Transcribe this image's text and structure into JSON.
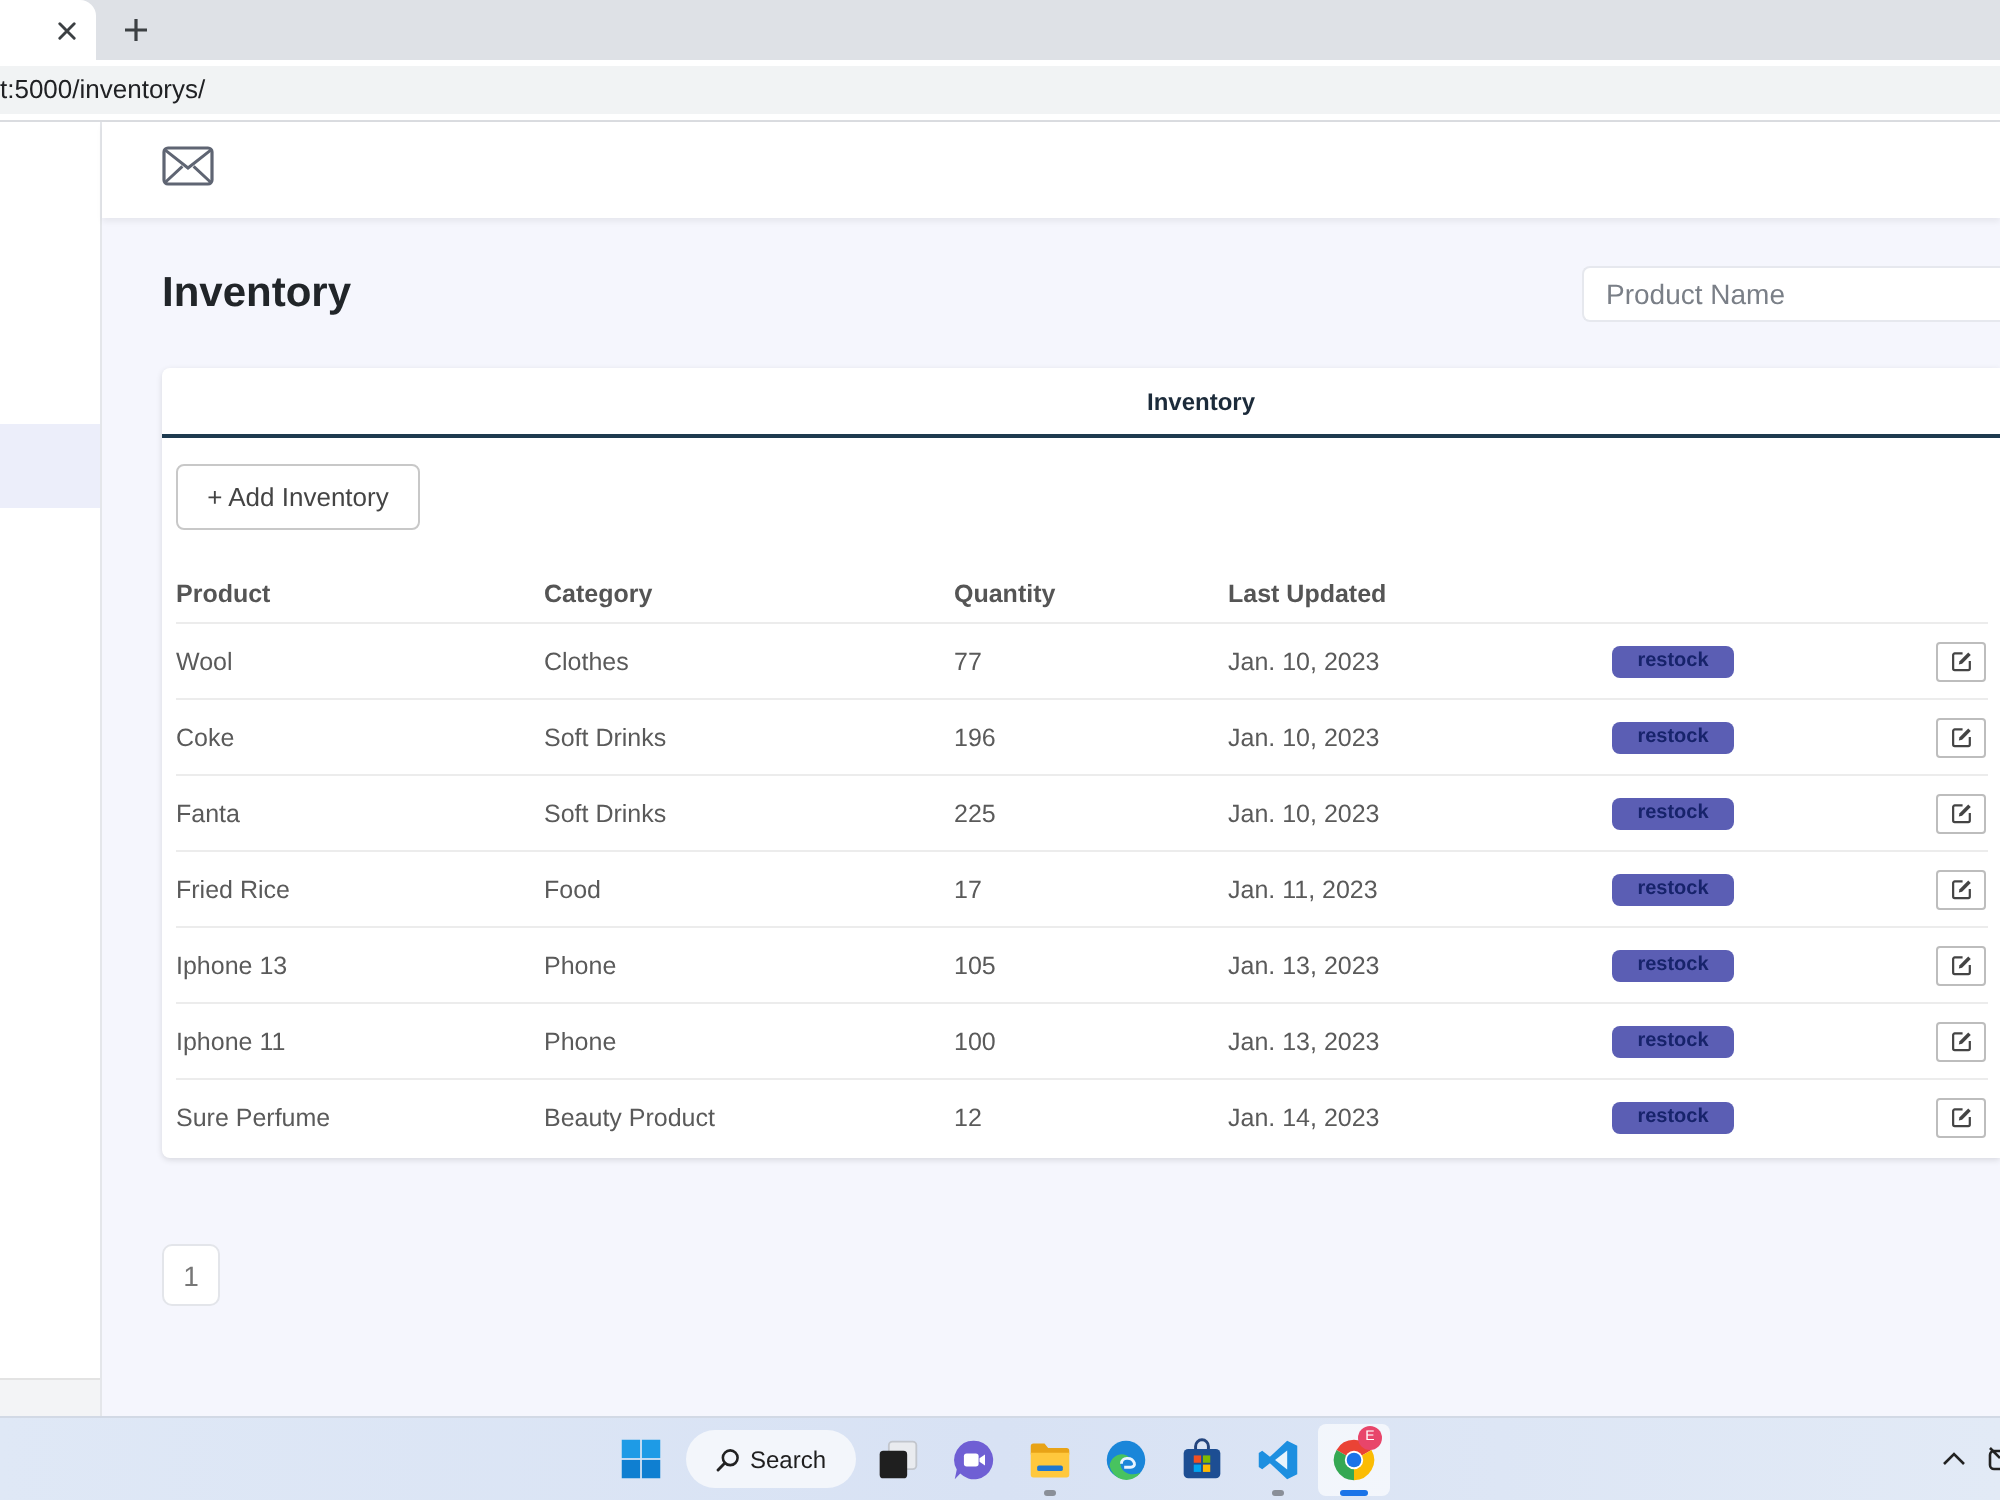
{
  "browser": {
    "tabs": [
      {
        "selected": true
      }
    ],
    "url": "t:5000/inventorys/"
  },
  "sidebar": {
    "items": [
      {
        "selected": true
      }
    ]
  },
  "page": {
    "title": "Inventory",
    "search": {
      "placeholder": "Product Name"
    }
  },
  "card": {
    "title": "Inventory",
    "add_button": "+ Add Inventory",
    "columns": [
      "Product",
      "Category",
      "Quantity",
      "Last Updated"
    ],
    "rows": [
      {
        "product": "Wool",
        "category": "Clothes",
        "quantity": "77",
        "last_updated": "Jan. 10, 2023",
        "status": "restock"
      },
      {
        "product": "Coke",
        "category": "Soft Drinks",
        "quantity": "196",
        "last_updated": "Jan. 10, 2023",
        "status": "restock"
      },
      {
        "product": "Fanta",
        "category": "Soft Drinks",
        "quantity": "225",
        "last_updated": "Jan. 10, 2023",
        "status": "restock"
      },
      {
        "product": "Fried Rice",
        "category": "Food",
        "quantity": "17",
        "last_updated": "Jan. 11, 2023",
        "status": "restock"
      },
      {
        "product": "Iphone 13",
        "category": "Phone",
        "quantity": "105",
        "last_updated": "Jan. 13, 2023",
        "status": "restock"
      },
      {
        "product": "Iphone 11",
        "category": "Phone",
        "quantity": "100",
        "last_updated": "Jan. 13, 2023",
        "status": "restock"
      },
      {
        "product": "Sure Perfume",
        "category": "Beauty Product",
        "quantity": "12",
        "last_updated": "Jan. 14, 2023",
        "status": "restock"
      }
    ]
  },
  "pagination": {
    "pages": [
      {
        "label": "1",
        "selected": false
      }
    ]
  },
  "taskbar": {
    "search_label": "Search",
    "apps": [
      {
        "kind": "taskview",
        "running": false,
        "active": false
      },
      {
        "kind": "chat",
        "running": false,
        "active": false
      },
      {
        "kind": "files",
        "running": true,
        "active": false
      },
      {
        "kind": "edge",
        "running": false,
        "active": false
      },
      {
        "kind": "store",
        "running": false,
        "active": false
      },
      {
        "kind": "vscode",
        "running": true,
        "active": false
      },
      {
        "kind": "chrome",
        "running": true,
        "active": true,
        "badge": "E"
      }
    ]
  }
}
